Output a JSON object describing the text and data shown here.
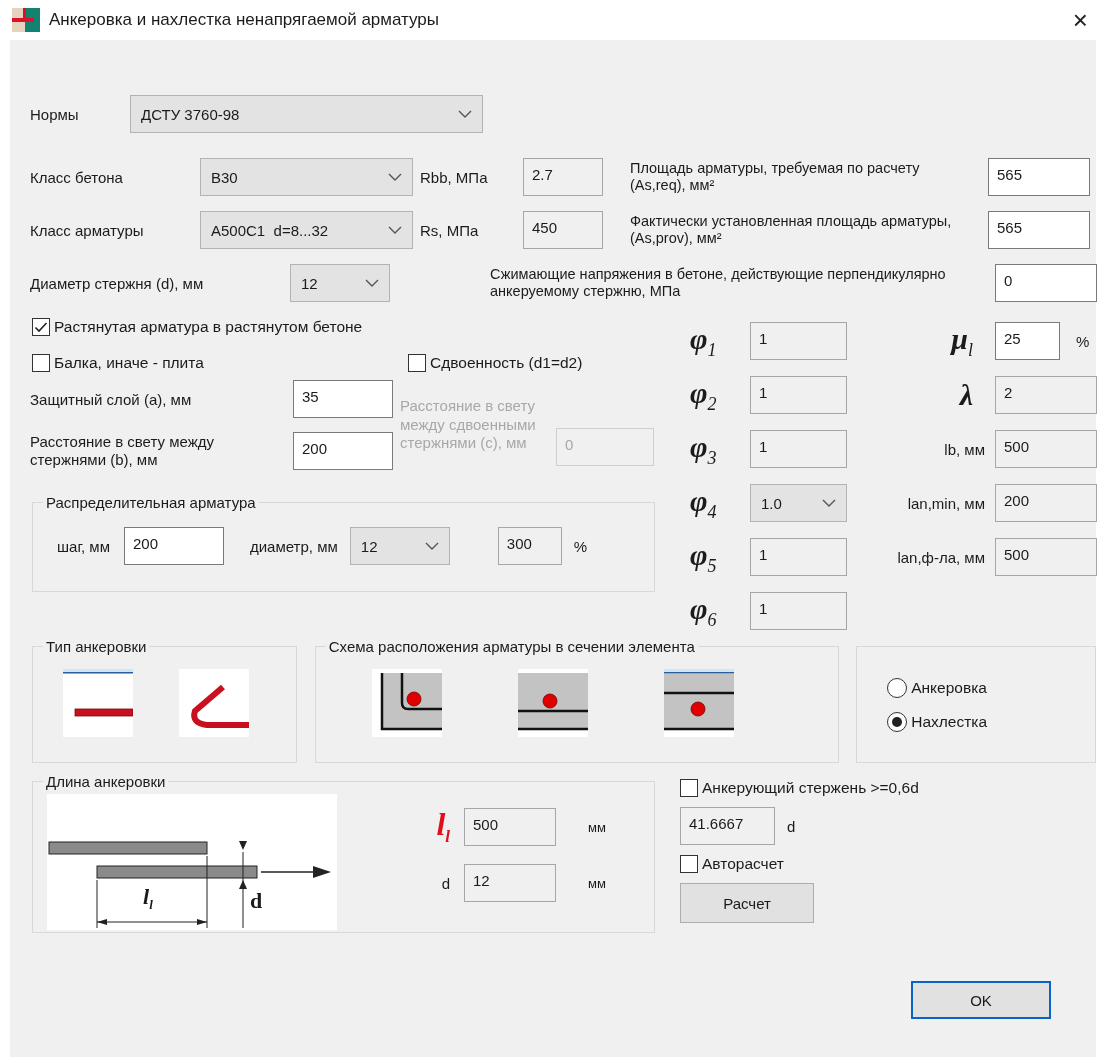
{
  "window": {
    "title": "Анкеровка и нахлестка ненапрягаемой арматуры",
    "close": "×"
  },
  "norms": {
    "label": "Нормы",
    "value": "ДСТУ 3760-98"
  },
  "concrete_class": {
    "label": "Класс бетона",
    "value": "B30"
  },
  "rebar_class": {
    "label": "Класс арматуры",
    "value": "A500C1  d=8...32"
  },
  "bar_diameter": {
    "label": "Диаметр стержня (d), мм",
    "value": "12"
  },
  "rbb": {
    "label": "Rbb, МПа",
    "value": "2.7",
    "readonly": true
  },
  "rs": {
    "label": "Rs, МПа",
    "value": "450",
    "readonly": true
  },
  "area_required": {
    "label": "Площадь арматуры, требуемая по расчету  (As,req), мм²",
    "value": "565",
    "readonly": false
  },
  "area_provided": {
    "label": "Фактически установленная площадь арматуры, (As,prov), мм²",
    "value": "565",
    "readonly": false
  },
  "compressive_stress": {
    "label": "Сжимающие напряжения в бетоне, действующие перпендикулярно анкеруемому стержню, МПа",
    "value": "0",
    "readonly": false
  },
  "tension_checkbox": {
    "label": "Растянутая арматура в растянутом бетоне",
    "checked": true
  },
  "beam_checkbox": {
    "label": "Балка, иначе - плита",
    "checked": false
  },
  "paired_checkbox": {
    "label": "Сдвоенность (d1=d2)",
    "checked": false
  },
  "cover": {
    "label": "Защитный слой (a), мм",
    "value": "35",
    "readonly": false
  },
  "clear_spacing": {
    "label": "Расстояние в свету между стержнями (b), мм",
    "value": "200",
    "readonly": false
  },
  "paired_spacing": {
    "label": "Расстояние в свету между сдвоенными стержнями (с), мм",
    "value": "0",
    "disabled": true
  },
  "distribution": {
    "title": "Распределительная арматура",
    "step_label": "шаг, мм",
    "step": {
      "value": "200",
      "readonly": false
    },
    "diameter_label": "диаметр, мм",
    "diameter": "12",
    "percent": {
      "value": "300",
      "readonly": true
    },
    "percent_unit": "%"
  },
  "factors": [
    {
      "symbol": "φ$_{1}$",
      "kind": "field",
      "value": "1"
    },
    {
      "symbol": "φ$_{2}$",
      "kind": "field",
      "value": "1"
    },
    {
      "symbol": "φ$_{3}$",
      "kind": "field",
      "value": "1"
    },
    {
      "symbol": "φ$_{4}$",
      "kind": "dropdown",
      "value": "1.0"
    },
    {
      "symbol": "φ$_{5}$",
      "kind": "field",
      "value": "1"
    },
    {
      "symbol": "φ$_{6}$",
      "kind": "field",
      "value": "1"
    }
  ],
  "results": [
    {
      "label": "μ$_{l}$",
      "kind": "symbol",
      "value": "25",
      "unit": "%",
      "readonly": false
    },
    {
      "label": "λ",
      "kind": "symbol",
      "value": "2",
      "readonly": true
    },
    {
      "label": "lb, мм",
      "kind": "text",
      "value": "500",
      "readonly": true
    },
    {
      "label": "lan,min, мм",
      "kind": "text",
      "value": "200",
      "readonly": true
    },
    {
      "label": "lan,ф-ла, мм",
      "kind": "text",
      "value": "500",
      "readonly": true
    }
  ],
  "anchor_type": {
    "title": "Тип анкеровки",
    "options": [
      {
        "kind": "straight",
        "selected": true
      },
      {
        "kind": "bent",
        "selected": false
      }
    ]
  },
  "layout_scheme": {
    "title": "Схема расположения арматуры в сечении элемента",
    "options": [
      {
        "kind": "corner",
        "selected": false
      },
      {
        "kind": "edge",
        "selected": false
      },
      {
        "kind": "middle",
        "selected": true
      }
    ]
  },
  "mode": [
    {
      "label": "Анкеровка",
      "selected": false
    },
    {
      "label": "Нахлестка",
      "selected": true
    }
  ],
  "length": {
    "title": "Длина анкеровки",
    "drawing_length_label": "l$_{l}$",
    "drawing_d_label": "d",
    "rows": [
      {
        "symbol": "l$_{l}$",
        "kind": "symbol",
        "value": "500",
        "unit": "мм",
        "readonly": true
      },
      {
        "symbol": "d",
        "kind": "text",
        "value": "12",
        "unit": "мм",
        "readonly": true
      }
    ]
  },
  "anchoring_bar_checkbox": {
    "label": "Анкерующий стержень >=0,6d",
    "checked": false
  },
  "ratio": {
    "value": "41.6667",
    "unit": "d",
    "readonly": true
  },
  "auto_checkbox": {
    "label": "Авторасчет",
    "checked": false
  },
  "calculate_button": "Расчет",
  "ok_button": "OK"
}
